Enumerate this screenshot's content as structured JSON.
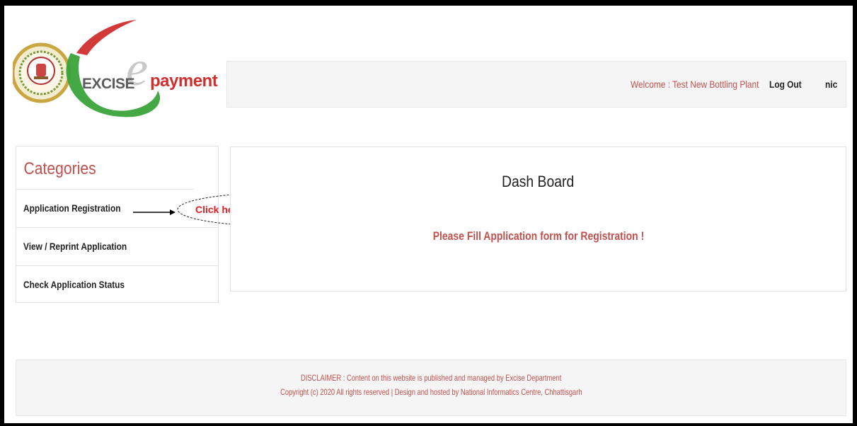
{
  "logo": {
    "brand_text": "EXCISE",
    "brand_text2": "payment",
    "seal_text": "छत्तीसगढ़ शासन"
  },
  "header": {
    "welcome": "Welcome : Test New Bottling Plant",
    "logout_label": "Log Out",
    "username": "nic"
  },
  "sidebar": {
    "title": "Categories",
    "items": [
      {
        "label": "Application Registration"
      },
      {
        "label": "View / Reprint Application"
      },
      {
        "label": "Check Application Status"
      }
    ]
  },
  "annotation": {
    "callout": "Click here for new registration"
  },
  "dashboard": {
    "title": "Dash Board",
    "message": "Please Fill Application form for Registration !"
  },
  "footer": {
    "disclaimer": "DISCLAIMER : Content on this website is published and managed by Excise Department",
    "copyright": "Copyright (c) 2020 All rights reserved | Design and hosted by National Informatics Centre, Chhattisgarh"
  },
  "colors": {
    "accent_red": "#c0504d",
    "callout_red": "#e02020",
    "panel_bg": "#f5f5f5"
  }
}
